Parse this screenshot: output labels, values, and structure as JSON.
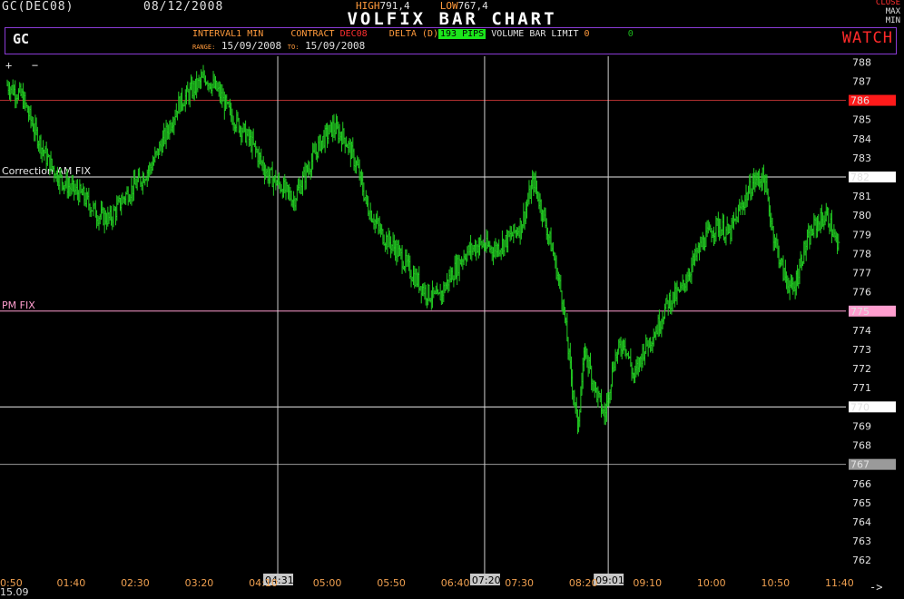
{
  "header": {
    "symbol": "GC(DEC08)",
    "date": "08/12/2008",
    "high_label": "HIGH",
    "high_value": "791,4",
    "low_label": "LOW",
    "low_value": "767,4",
    "title": "VOLFIX BAR CHART",
    "close_label": "CLOSE",
    "max_label": "MAX",
    "min_label": "MIN"
  },
  "panel": {
    "symbol": "GC",
    "interval_label": "INTERVAL",
    "interval_value": "1 MIN",
    "contract_label": "CONTRACT",
    "contract_value": "DEC08",
    "delta_label": "DELTA (D)",
    "delta_value": "193 PIPS",
    "volume_label": "VOLUME BAR LIMIT",
    "volume_value": "0",
    "extra_value": "0",
    "range_label": "RANGE:",
    "range_from": "15/09/2008",
    "to_label": "TO:",
    "range_to": "15/09/2008",
    "watch_label": "WATCH"
  },
  "toolbar": {
    "zoom_in": "+",
    "zoom_out": "−",
    "scroll_right": "->"
  },
  "bottom_date": "15.09",
  "colors": {
    "series": "#22cc22",
    "background": "#000000",
    "accent_orange": "#ff9a3c",
    "accent_purple": "#8a3bd6",
    "watch": "#ff2a2a"
  },
  "chart_data": {
    "type": "bar",
    "title": "VOLFIX BAR CHART",
    "y_ticks": [
      762,
      763,
      764,
      765,
      766,
      767,
      768,
      769,
      770,
      771,
      772,
      773,
      774,
      775,
      776,
      777,
      778,
      779,
      780,
      781,
      782,
      783,
      784,
      785,
      786,
      787,
      788
    ],
    "ylim": [
      761.3,
      788.3
    ],
    "x_ticks": [
      "0:50",
      "01:40",
      "02:30",
      "03:20",
      "04:10",
      "05:00",
      "05:50",
      "06:40",
      "07:30",
      "08:20",
      "09:10",
      "10:00",
      "10:50",
      "11:40"
    ],
    "x_range_minutes": [
      50,
      730
    ],
    "series": [
      {
        "values": [
          {
            "t": 50,
            "v": 786.8
          },
          {
            "t": 62,
            "v": 786.2
          },
          {
            "t": 72,
            "v": 784.5
          },
          {
            "t": 82,
            "v": 783.0
          },
          {
            "t": 92,
            "v": 782.0
          },
          {
            "t": 100,
            "v": 781.5
          },
          {
            "t": 112,
            "v": 781.0
          },
          {
            "t": 124,
            "v": 780.0
          },
          {
            "t": 134,
            "v": 779.8
          },
          {
            "t": 146,
            "v": 781.0
          },
          {
            "t": 158,
            "v": 781.8
          },
          {
            "t": 168,
            "v": 782.6
          },
          {
            "t": 178,
            "v": 784.0
          },
          {
            "t": 190,
            "v": 785.8
          },
          {
            "t": 202,
            "v": 786.6
          },
          {
            "t": 212,
            "v": 787.2
          },
          {
            "t": 222,
            "v": 786.5
          },
          {
            "t": 232,
            "v": 785.3
          },
          {
            "t": 242,
            "v": 784.5
          },
          {
            "t": 252,
            "v": 783.5
          },
          {
            "t": 262,
            "v": 782.2
          },
          {
            "t": 274,
            "v": 781.5
          },
          {
            "t": 284,
            "v": 780.8
          },
          {
            "t": 296,
            "v": 782.5
          },
          {
            "t": 306,
            "v": 783.8
          },
          {
            "t": 316,
            "v": 784.6
          },
          {
            "t": 326,
            "v": 784.0
          },
          {
            "t": 336,
            "v": 782.5
          },
          {
            "t": 344,
            "v": 780.5
          },
          {
            "t": 356,
            "v": 779.0
          },
          {
            "t": 368,
            "v": 778.2
          },
          {
            "t": 380,
            "v": 777.0
          },
          {
            "t": 392,
            "v": 776.0
          },
          {
            "t": 402,
            "v": 775.6
          },
          {
            "t": 412,
            "v": 776.8
          },
          {
            "t": 424,
            "v": 778.0
          },
          {
            "t": 436,
            "v": 778.5
          },
          {
            "t": 448,
            "v": 778.2
          },
          {
            "t": 460,
            "v": 778.8
          },
          {
            "t": 470,
            "v": 779.5
          },
          {
            "t": 480,
            "v": 781.8
          },
          {
            "t": 488,
            "v": 780.0
          },
          {
            "t": 496,
            "v": 778.0
          },
          {
            "t": 504,
            "v": 775.5
          },
          {
            "t": 510,
            "v": 772.0
          },
          {
            "t": 516,
            "v": 769.0
          },
          {
            "t": 522,
            "v": 773.0
          },
          {
            "t": 530,
            "v": 771.0
          },
          {
            "t": 538,
            "v": 769.5
          },
          {
            "t": 546,
            "v": 772.5
          },
          {
            "t": 554,
            "v": 773.5
          },
          {
            "t": 562,
            "v": 771.5
          },
          {
            "t": 570,
            "v": 773.0
          },
          {
            "t": 580,
            "v": 774.0
          },
          {
            "t": 590,
            "v": 775.5
          },
          {
            "t": 600,
            "v": 776.0
          },
          {
            "t": 610,
            "v": 777.5
          },
          {
            "t": 620,
            "v": 778.8
          },
          {
            "t": 630,
            "v": 779.5
          },
          {
            "t": 640,
            "v": 779.0
          },
          {
            "t": 650,
            "v": 780.5
          },
          {
            "t": 660,
            "v": 781.8
          },
          {
            "t": 668,
            "v": 782.0
          },
          {
            "t": 676,
            "v": 779.0
          },
          {
            "t": 684,
            "v": 777.0
          },
          {
            "t": 692,
            "v": 776.0
          },
          {
            "t": 700,
            "v": 778.0
          },
          {
            "t": 710,
            "v": 779.5
          },
          {
            "t": 720,
            "v": 780.0
          },
          {
            "t": 730,
            "v": 778.0
          }
        ]
      }
    ],
    "hlines": [
      {
        "value": 786.0,
        "label": "",
        "color": "#b03030",
        "tag": "786",
        "tag_bg": "#ff1a1a",
        "tag_fg": "#ffffff"
      },
      {
        "value": 782.0,
        "label": "Correction AM FIX",
        "color": "#e8e8e8",
        "tag": "782",
        "tag_bg": "#ffffff",
        "tag_fg": "#000000"
      },
      {
        "value": 775.0,
        "label": "PM FIX",
        "color": "#ff9ecf",
        "tag": "775",
        "tag_bg": "#ff9ecf",
        "tag_fg": "#000000"
      },
      {
        "value": 770.0,
        "label": "",
        "color": "#e8e8e8",
        "tag": "770",
        "tag_bg": "#ffffff",
        "tag_fg": "#000000"
      },
      {
        "value": 767.0,
        "label": "",
        "color": "#9a9a9a",
        "tag": "767",
        "tag_bg": "#9a9a9a",
        "tag_fg": "#000000"
      }
    ],
    "vcursors": [
      {
        "time": "04:31",
        "minutes": 271
      },
      {
        "time": "07:20",
        "minutes": 440
      },
      {
        "time": "09:01",
        "minutes": 541
      }
    ],
    "grid": false
  }
}
